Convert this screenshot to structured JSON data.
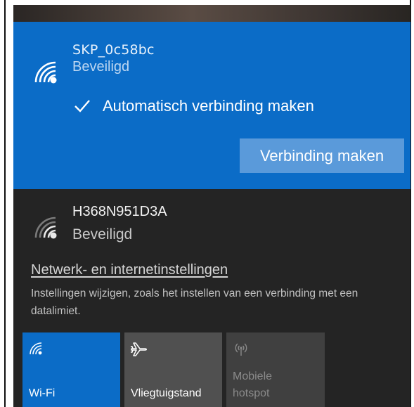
{
  "networks": [
    {
      "ssid": "SKP_0c58bc",
      "security": "Beveiligd",
      "selected": true,
      "auto_connect_label": "Automatisch verbinding maken",
      "auto_connect_checked": true,
      "connect_button": "Verbinding maken",
      "icon": "wifi-signal-icon"
    },
    {
      "ssid": "H368N951D3A",
      "security": "Beveiligd",
      "selected": false,
      "icon": "wifi-signal-icon"
    }
  ],
  "settings": {
    "link": "Netwerk- en internetinstellingen",
    "description": "Instellingen wijzigen, zoals het instellen van een verbinding met een datalimiet."
  },
  "quick_actions": [
    {
      "label": "Wi-Fi",
      "icon": "wifi-icon",
      "active": true,
      "enabled": true
    },
    {
      "label": "Vliegtuigstand",
      "icon": "airplane-icon",
      "active": false,
      "enabled": true
    },
    {
      "label": "Mobiele hotspot",
      "icon": "hotspot-icon",
      "active": false,
      "enabled": false
    }
  ],
  "colors": {
    "accent": "#0b6cc7",
    "button": "#5a9ada",
    "panel": "#242424",
    "tile_inactive": "#505050",
    "tile_disabled": "#404040"
  }
}
